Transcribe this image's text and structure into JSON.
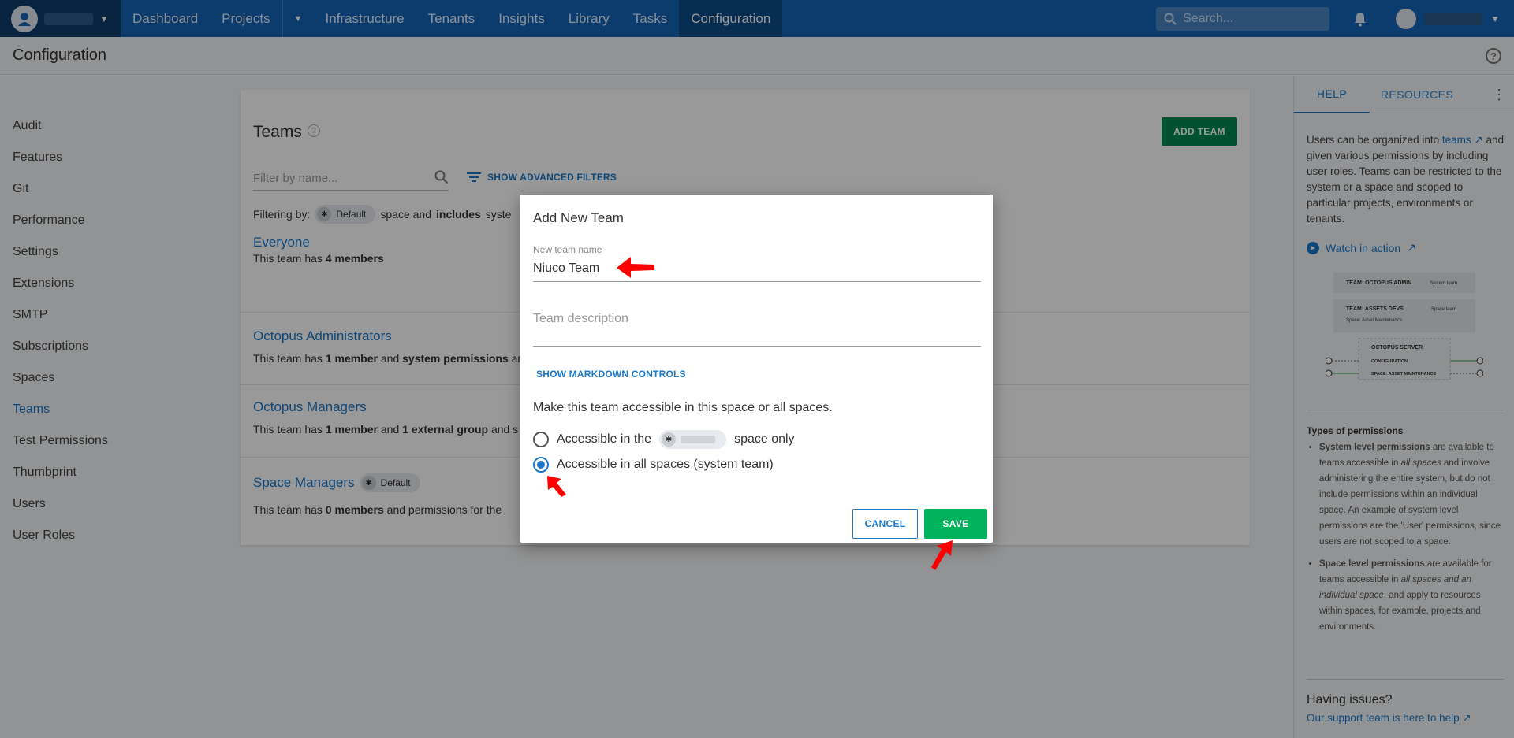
{
  "nav": {
    "items": [
      "Dashboard",
      "Projects",
      "Infrastructure",
      "Tenants",
      "Insights",
      "Library",
      "Tasks",
      "Configuration"
    ],
    "search_placeholder": "Search..."
  },
  "titlebar": {
    "title": "Configuration"
  },
  "left_nav": {
    "items": [
      "Audit",
      "Features",
      "Git",
      "Performance",
      "Settings",
      "Extensions",
      "SMTP",
      "Subscriptions",
      "Spaces",
      "Teams",
      "Test Permissions",
      "Thumbprint",
      "Users",
      "User Roles"
    ],
    "active": "Teams"
  },
  "teams_card": {
    "title": "Teams",
    "add_button": "ADD TEAM",
    "filter_placeholder": "Filter by name...",
    "advanced_filters": "SHOW ADVANCED FILTERS",
    "filtering_by_label": "Filtering by:",
    "filtering_chip": "Default",
    "filtering_suffix": "space and",
    "filtering_bold": "includes",
    "filtering_tail": "syste",
    "rows": [
      {
        "name": "Everyone",
        "d1": "This team has",
        "b1": "4 members",
        "d2": "",
        "b2": "",
        "d3": ""
      },
      {
        "name": "Octopus Administrators",
        "d1": "This team has",
        "b1": "1 member",
        "d2": "and",
        "b2": "system permissions",
        "d3": "ar"
      },
      {
        "name": "Octopus Managers",
        "d1": "This team has",
        "b1": "1 member",
        "d2": "and",
        "b2": "1 external group",
        "d3": "and s"
      },
      {
        "name": "Space Managers",
        "chip": "Default",
        "d1": "This team has",
        "b1": "0 members",
        "d2": "and permissions for the",
        "b2": "",
        "d3": ""
      }
    ]
  },
  "right_panel": {
    "tab_help": "HELP",
    "tab_resources": "RESOURCES",
    "help_p1": "Users can be organized into",
    "help_link": "teams",
    "help_p2": "and given various permissions by including user roles. Teams can be restricted to the system or a space and scoped to particular projects, environments or tenants.",
    "watch": "Watch in action",
    "diagram_labels": [
      "TEAM: OCTOPUS ADMIN",
      "System team",
      "TEAM: ASSETS DEVS",
      "Space team",
      "Space: Asset Maintenance",
      "OCTOPUS SERVER",
      "CONFIGURATION",
      "SPACE: ASSET MAINTENANCE"
    ],
    "types_title": "Types of permissions",
    "sys_bold": "System level permissions",
    "sys_text1": "are available to teams accessible in",
    "sys_italic": "all spaces",
    "sys_text2": "and involve administering the entire system, but do not include permissions within an individual space. An example of system level permissions are the 'User' permissions, since users are not scoped to a space.",
    "space_bold": "Space level permissions",
    "space_text1": "are available for teams accessible in",
    "space_italic": "all spaces and an individual space",
    "space_text2": ", and apply to resources within spaces, for example, projects and environments.",
    "issues_title": "Having issues?",
    "issues_link": "Our support team is here to help"
  },
  "dialog": {
    "title": "Add New Team",
    "name_label": "New team name",
    "name_value": "Niuco Team",
    "description_placeholder": "Team description",
    "markdown": "SHOW MARKDOWN CONTROLS",
    "access_question": "Make this team accessible in this space or all spaces.",
    "option1_prefix": "Accessible in the",
    "option1_suffix": "space only",
    "option2": "Accessible in all spaces (system team)",
    "selected_option": 2,
    "cancel": "CANCEL",
    "save": "SAVE"
  },
  "colors": {
    "nav_blue": "#1565b6",
    "accent_blue": "#1a77ca",
    "add_green": "#00874f",
    "save_green": "#00b35c",
    "annotation_red": "#ff0000"
  }
}
